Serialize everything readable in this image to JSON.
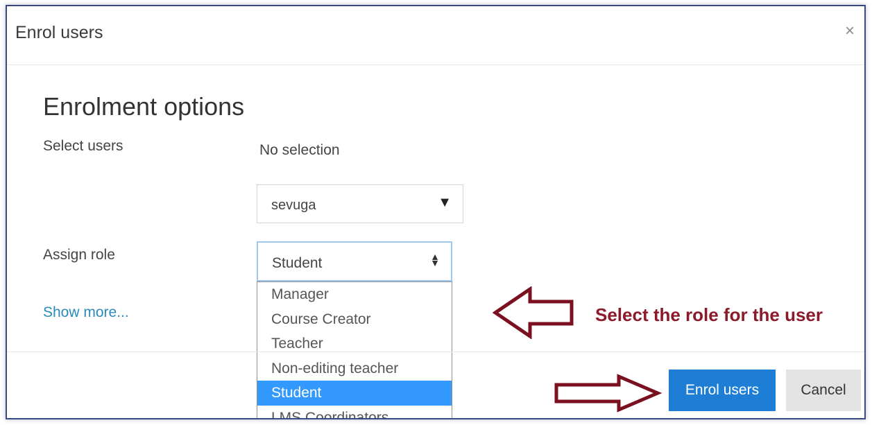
{
  "modal": {
    "title": "Enrol users",
    "close_glyph": "×",
    "heading": "Enrolment options"
  },
  "select_users": {
    "label": "Select users",
    "value": "No selection",
    "search_value": "sevuga",
    "dropdown_icon": "triangle-down-icon"
  },
  "assign_role": {
    "label": "Assign role",
    "selected": "Student",
    "updown_glyph": "◆",
    "options": [
      "Manager",
      "Course Creator",
      "Teacher",
      "Non-editing teacher",
      "Student",
      "LMS Coordinators"
    ],
    "selected_index": 4
  },
  "show_more": "Show more...",
  "annotation": {
    "text": "Select the role for the user",
    "color": "#8b1a2a"
  },
  "footer": {
    "primary_label": "Enrol users",
    "secondary_label": "Cancel"
  },
  "colors": {
    "primary": "#1e7ed6",
    "selection": "#3399ff",
    "link": "#2a8ab8"
  }
}
